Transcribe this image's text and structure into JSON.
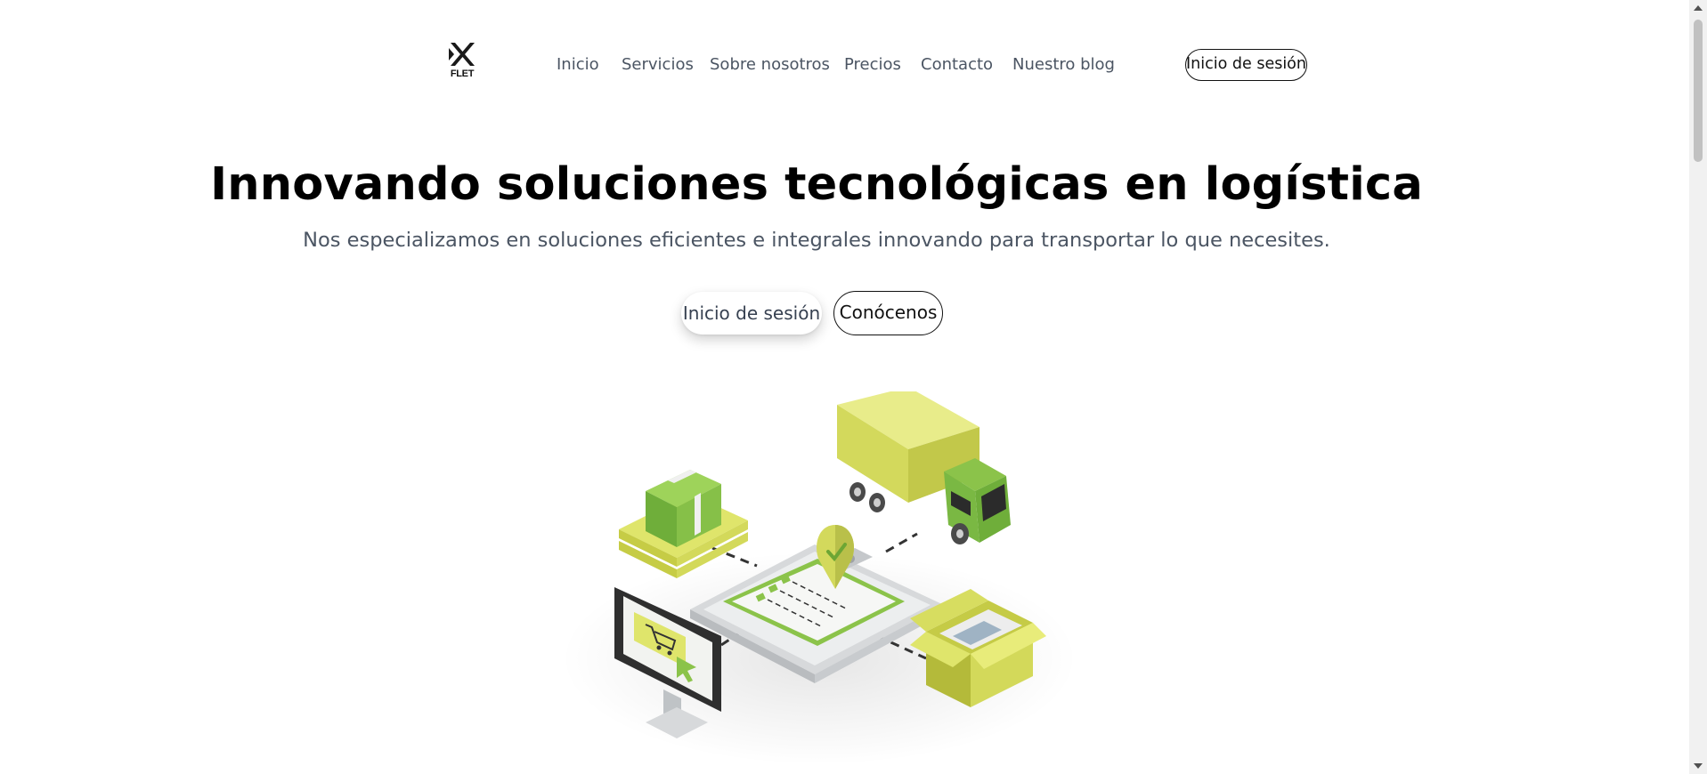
{
  "header": {
    "logo_text": "FLET",
    "nav": [
      {
        "label": "Inicio"
      },
      {
        "label": "Servicios"
      },
      {
        "label": "Sobre nosotros"
      },
      {
        "label": "Precios"
      },
      {
        "label": "Contacto"
      },
      {
        "label": "Nuestro blog"
      }
    ],
    "login_label": "Inicio de sesión"
  },
  "hero": {
    "title": "Innovando soluciones tecnológicas en logística",
    "subtitle": "Nos especializamos en soluciones eficientes e integrales innovando para transportar lo que necesites.",
    "primary_button": "Inicio de sesión",
    "secondary_button": "Conócenos"
  },
  "illustration": {
    "icons": [
      "pallet-box-icon",
      "truck-icon",
      "clipboard-checklist-icon",
      "location-pin-icon",
      "monitor-cart-icon",
      "open-box-icon"
    ]
  },
  "colors": {
    "accent_green": "#8bc34a",
    "accent_lime": "#dfe56b",
    "text_muted": "#4b5563",
    "text_dark": "#000000"
  }
}
